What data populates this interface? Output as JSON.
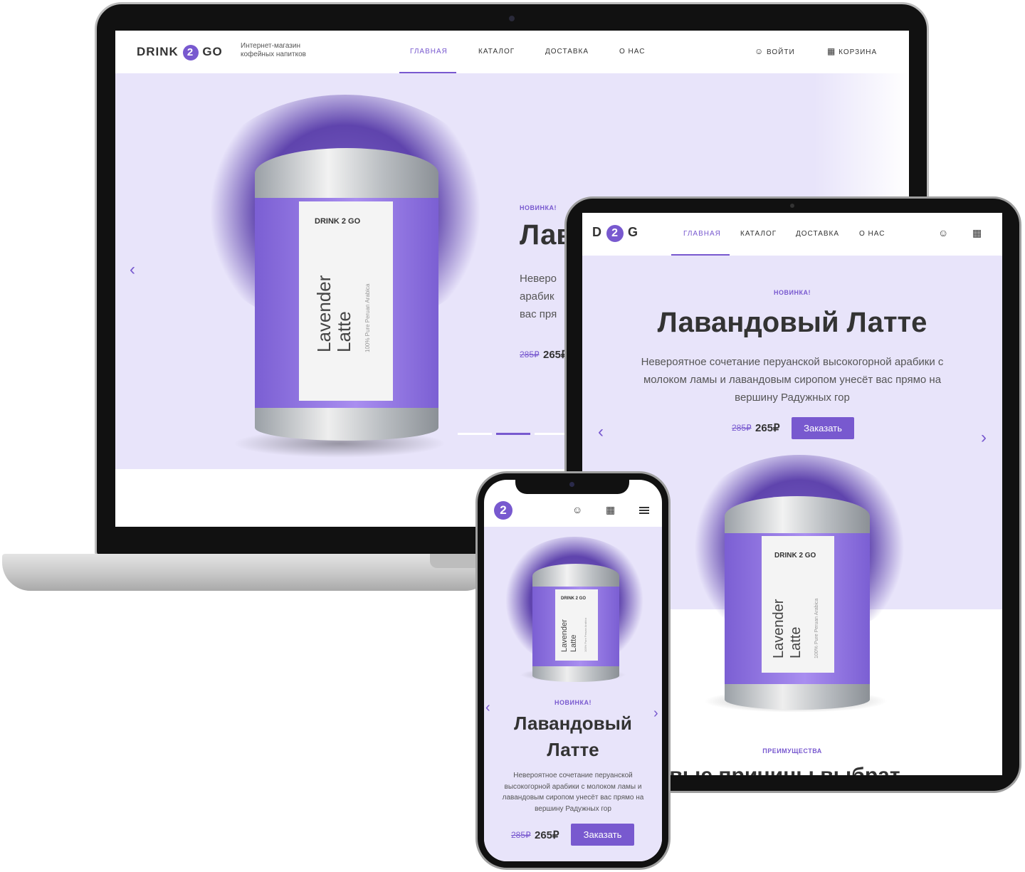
{
  "brand": {
    "name_left": "DRINK",
    "name_two": "2",
    "name_right": "GO",
    "short_left": "D",
    "short_right": "G",
    "tagline": "Интернет-магазин кофейных напитков"
  },
  "nav": {
    "home": "ГЛАВНАЯ",
    "catalog": "КАТАЛОГ",
    "delivery": "ДОСТАВКА",
    "about": "О НАС",
    "login": "ВОЙТИ",
    "cart": "КОРЗИНА"
  },
  "hero": {
    "label": "НОВИНКА!",
    "title": "Лавандовый Латте",
    "title_line1": "Лавандовый",
    "title_line2": "Латте",
    "laptop_title_cut": "Лав",
    "laptop_desc_lines": [
      "Неверо",
      "арабик",
      "вас пря"
    ],
    "desc": "Невероятное сочетание перуанской высокогорной арабики с молоком ламы и лавандовым сиропом унесёт вас прямо на вершину Радужных гор",
    "price_old": "285₽",
    "price_new": "265₽",
    "price_new_cut": "265₽",
    "order_button": "Заказать"
  },
  "product": {
    "brand": "DRINK 2 GO",
    "name_line1": "Lavender",
    "name_line2": "Latte",
    "subtitle": "100% Pure Peruan Arabica"
  },
  "advantages": {
    "label": "ПРЕИМУЩЕСТВА",
    "title_cut": "овые причины выбрат"
  },
  "slider": {
    "active_index": 1,
    "count": 3
  },
  "icons": {
    "user": "user-icon",
    "cart": "basket-icon",
    "menu": "menu-icon",
    "prev": "chevron-left-icon",
    "next": "chevron-right-icon"
  },
  "colors": {
    "accent": "#7859cf",
    "hero_bg": "#e8e4fa",
    "text": "#333333"
  }
}
